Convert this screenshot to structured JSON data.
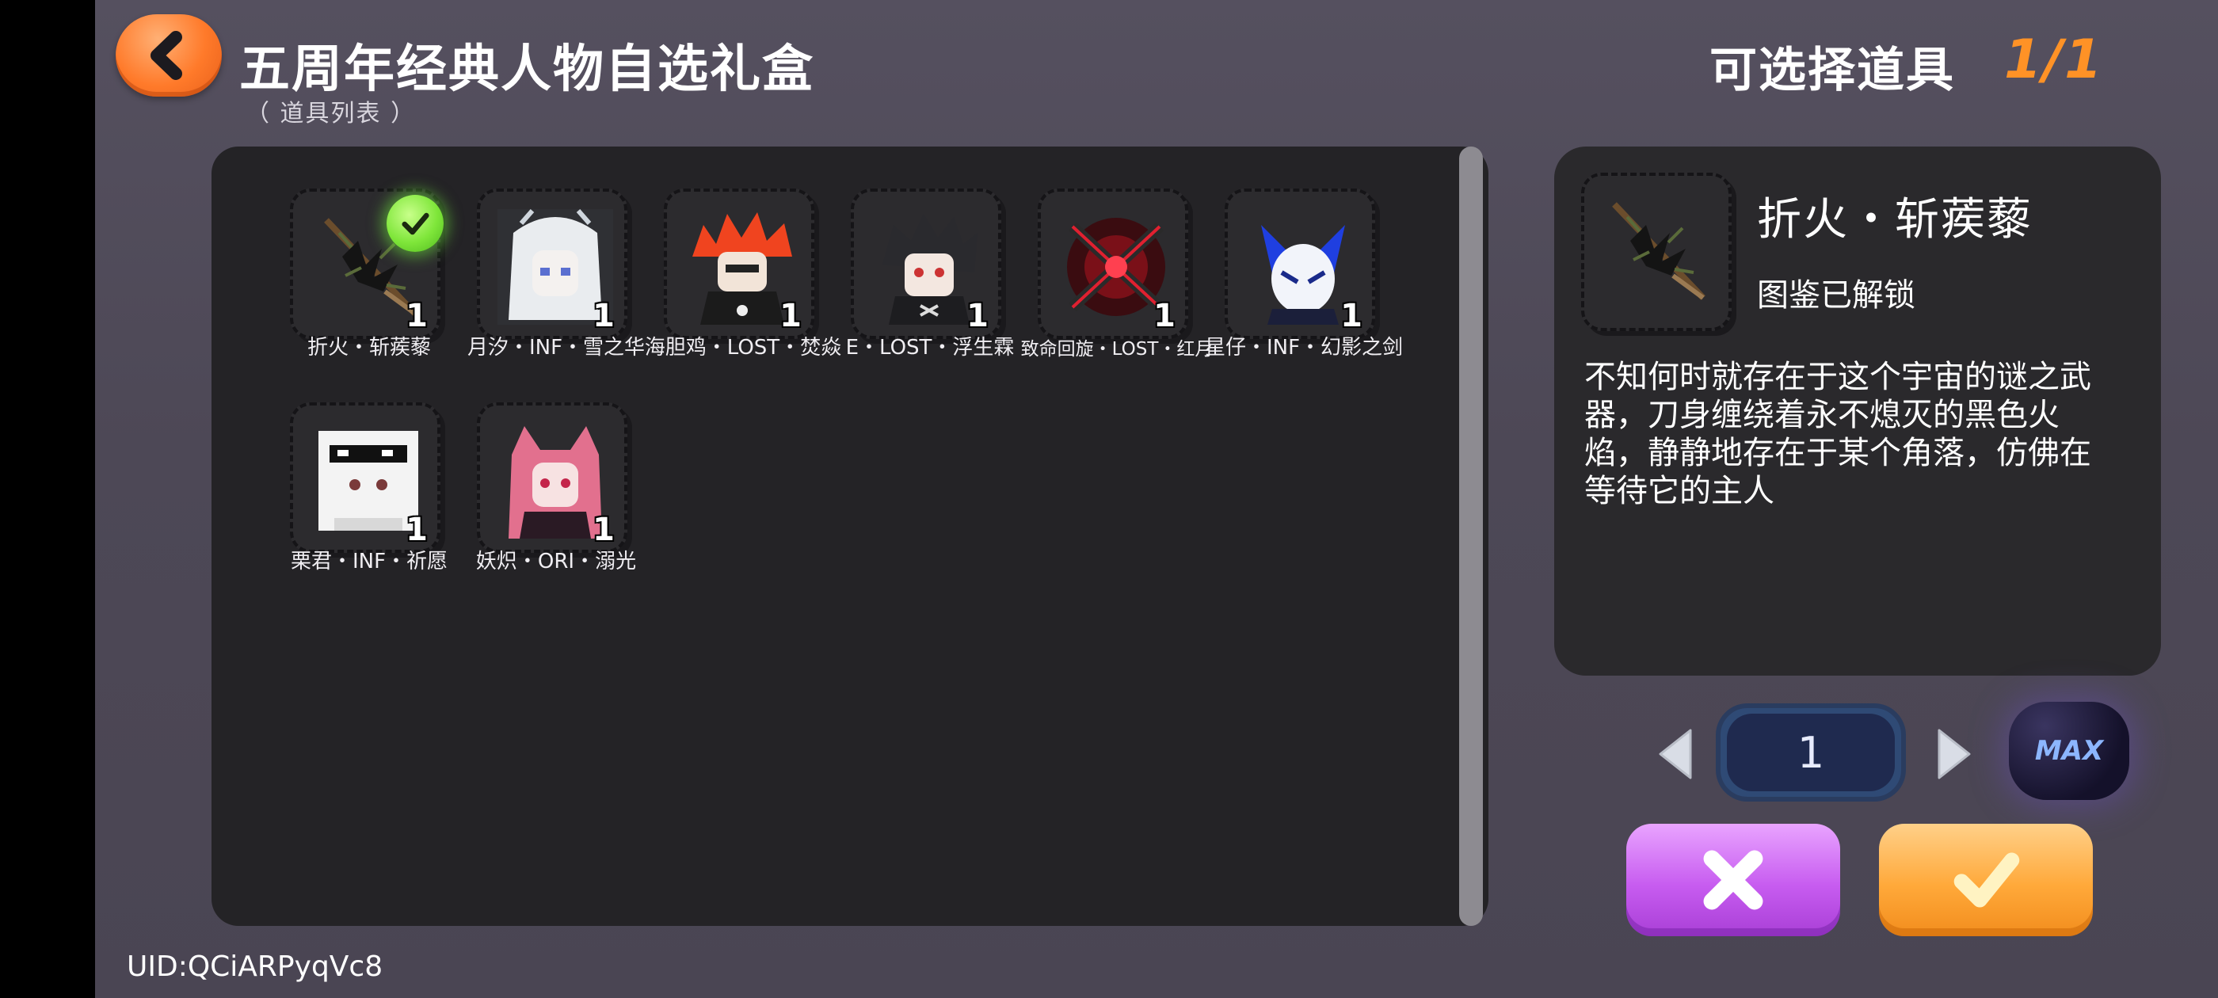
{
  "header": {
    "title": "五周年经典人物自选礼盒",
    "subtitle": "（ 道具列表 ）",
    "select_label": "可选择道具",
    "select_count": "1/1"
  },
  "items": [
    {
      "name": "折火・斩蒺藜",
      "qty": "1",
      "selected": true,
      "icon": "dark-spear-weapon"
    },
    {
      "name": "月汐・INF・雪之华",
      "qty": "1",
      "selected": false,
      "icon": "white-hair-character"
    },
    {
      "name": "海胆鸡・LOST・焚焱",
      "qty": "1",
      "selected": false,
      "icon": "red-spiky-hair-character"
    },
    {
      "name": "E・LOST・浮生霖",
      "qty": "1",
      "selected": false,
      "icon": "dark-hair-character"
    },
    {
      "name": "致命回旋・LOST・红月",
      "qty": "1",
      "selected": false,
      "icon": "red-crossed-blades"
    },
    {
      "name": "星仔・INF・幻影之剑",
      "qty": "1",
      "selected": false,
      "icon": "blue-white-mask-character"
    },
    {
      "name": "栗君・INF・祈愿",
      "qty": "1",
      "selected": false,
      "icon": "white-hair-sunglasses-character"
    },
    {
      "name": "妖炽・ORI・溺光",
      "qty": "1",
      "selected": false,
      "icon": "pink-hair-fox-character"
    }
  ],
  "detail": {
    "name": "折火・斩蒺藜",
    "status": "图鉴已解锁",
    "description": "不知何时就存在于这个宇宙的谜之武器，刀身缠绕着永不熄灭的黑色火焰，静静地存在于某个角落，仿佛在等待它的主人"
  },
  "quantity": {
    "value": "1",
    "max_label": "MAX"
  },
  "footer": {
    "uid": "UID:QCiARPyqVc8"
  },
  "colors": {
    "accent_orange": "#ff9226",
    "cancel_purple": "#c75cf0",
    "confirm_orange": "#ffa93a",
    "selected_green": "#7fe63a"
  }
}
